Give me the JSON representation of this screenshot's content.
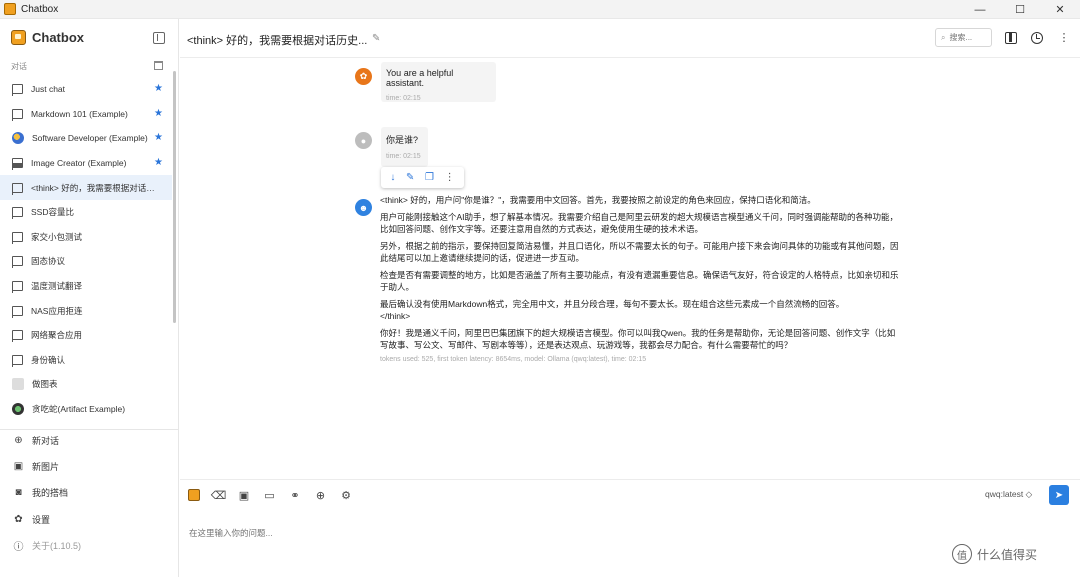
{
  "window": {
    "title": "Chatbox",
    "minimize": "—",
    "maximize": "☐",
    "close": "✕"
  },
  "sidebar": {
    "brand": "Chatbox",
    "section_label": "对话",
    "conversations": [
      {
        "label": "Just chat",
        "starred": true
      },
      {
        "label": "Markdown 101 (Example)",
        "starred": true
      },
      {
        "label": "Software Developer (Example)",
        "starred": true
      },
      {
        "label": "Image Creator (Example)",
        "starred": true
      },
      {
        "label": "<think> 好的，我需要根据对话历史...",
        "starred": false,
        "active": true
      },
      {
        "label": "SSD容量比",
        "starred": false
      },
      {
        "label": "家交小包测试",
        "starred": false
      },
      {
        "label": "固态协议",
        "starred": false
      },
      {
        "label": "温度测试翻译",
        "starred": false
      },
      {
        "label": "NAS应用拒连",
        "starred": false
      },
      {
        "label": "网络聚合应用",
        "starred": false
      },
      {
        "label": "身份确认",
        "starred": false
      },
      {
        "label": "做图表",
        "starred": false
      },
      {
        "label": "贪吃蛇(Artifact Example)",
        "starred": false
      }
    ],
    "bottom_nav": [
      {
        "label": "新对话",
        "icon": "plus-circle-icon"
      },
      {
        "label": "新图片",
        "icon": "image-icon"
      },
      {
        "label": "我的搭档",
        "icon": "bot-icon"
      },
      {
        "label": "设置",
        "icon": "gear-icon"
      },
      {
        "label": "关于(1.10.5)",
        "icon": "info-icon"
      }
    ],
    "star_glyph": "★"
  },
  "header": {
    "title": "<think> 好的，我需要根据对话历史...",
    "search_placeholder": "搜索..."
  },
  "messages": {
    "system": {
      "text": "You are a helpful assistant.",
      "time": "time: 02:15"
    },
    "user": {
      "text": "你是谁?",
      "time": "time: 02:15"
    },
    "assistant": {
      "paragraphs": [
        "<think> 好的，用户问\"你是谁？\"，我需要用中文回答。首先，我要按照之前设定的角色来回应，保持口语化和简洁。",
        "用户可能刚接触这个AI助手，想了解基本情况。我需要介绍自己是阿里云研发的超大规模语言模型通义千问，同时强调能帮助的各种功能，比如回答问题、创作文字等。还要注意用自然的方式表达，避免使用生硬的技术术语。",
        "另外，根据之前的指示，要保持回复简洁易懂，并且口语化，所以不需要太长的句子。可能用户接下来会询问具体的功能或有其他问题，因此结尾可以加上邀请继续提问的话，促进进一步互动。",
        "检查是否有需要调整的地方，比如是否涵盖了所有主要功能点，有没有遗漏重要信息。确保语气友好，符合设定的人格特点，比如亲切和乐于助人。",
        "最后确认没有使用Markdown格式，完全用中文，并且分段合理，每句不要太长。现在组合这些元素成一个自然流畅的回答。\n</think>",
        "你好！我是通义千问，阿里巴巴集团旗下的超大规模语言模型。你可以叫我Qwen。我的任务是帮助你，无论是回答问题、创作文字（比如写故事、写公文、写邮件、写剧本等等），还是表达观点、玩游戏等，我都会尽力配合。有什么需要帮忙的吗？"
      ],
      "meta": "tokens used: 525, first token latency: 8654ms, model: Ollama (qwq:latest), time: 02:15"
    }
  },
  "input": {
    "model": "qwq:latest ◇",
    "placeholder": "在这里输入你的问题..."
  },
  "watermark": {
    "glyph": "值",
    "text": "什么值得买"
  }
}
